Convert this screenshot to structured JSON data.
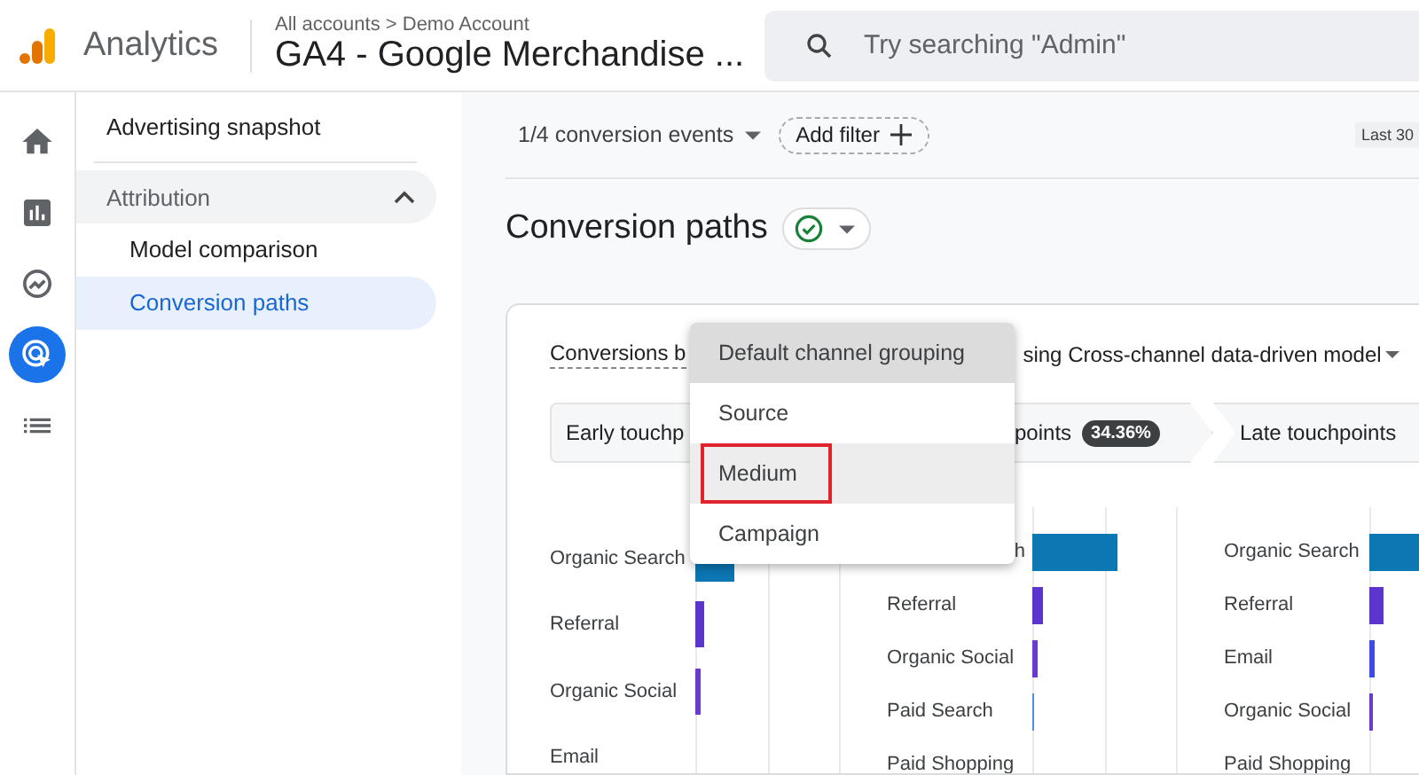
{
  "header": {
    "app_name": "Analytics",
    "breadcrumb": "All accounts > Demo Account",
    "property": "GA4 - Google Merchandise ...",
    "search": {
      "placeholder": "Try searching \"Admin\""
    }
  },
  "rail": [
    {
      "selected": false
    },
    {
      "selected": false
    },
    {
      "selected": false
    },
    {
      "selected": true
    },
    {
      "selected": false
    }
  ],
  "sidebar": {
    "items": [
      {
        "label": "Advertising snapshot",
        "kind": "link",
        "selected": false
      },
      {
        "label": "Attribution",
        "kind": "group",
        "expanded": true,
        "children": [
          {
            "label": "Model comparison",
            "selected": false
          },
          {
            "label": "Conversion paths",
            "selected": true
          }
        ]
      }
    ]
  },
  "toolbar": {
    "events": "1/4 conversion events",
    "add_filter": "Add filter",
    "date_range": "Last 30"
  },
  "page_title": "Conversion paths",
  "card": {
    "heading_start": "Conversions b",
    "heading_end": "sing Cross-channel data-driven model",
    "tabs": [
      {
        "label": "Early touchp"
      },
      {
        "label": "points",
        "badge": "34.36%"
      },
      {
        "label": "Late touchpoints"
      }
    ],
    "columns": [
      {
        "rows": [
          {
            "label": "Organic Search",
            "clipped": false,
            "color": "#0b77b3"
          },
          {
            "label": "Referral",
            "clipped": false,
            "color": "#5c35cc"
          },
          {
            "label": "Organic Social",
            "clipped": false,
            "color": "#6b3bd0"
          },
          {
            "label": "Email",
            "clipped": false
          }
        ]
      },
      {
        "rows": [
          {
            "label": "h",
            "clipped": true,
            "color": "#0b77b3"
          },
          {
            "label": "Referral",
            "clipped": false,
            "color": "#5c35cc"
          },
          {
            "label": "Organic Social",
            "clipped": false,
            "color": "#6b3bd0"
          },
          {
            "label": "Paid Search",
            "clipped": false,
            "color": "#4e8fe8"
          },
          {
            "label": "Paid Shopping",
            "clipped": false
          }
        ]
      },
      {
        "rows": [
          {
            "label": "Organic Search",
            "clipped": false,
            "color": "#0b77b3"
          },
          {
            "label": "Referral",
            "clipped": false,
            "color": "#5c35cc"
          },
          {
            "label": "Email",
            "clipped": false,
            "color": "#3b4ce6"
          },
          {
            "label": "Organic Social",
            "clipped": false,
            "color": "#6b3bd0"
          },
          {
            "label": "Paid Shopping",
            "clipped": false
          }
        ]
      }
    ]
  },
  "menu": {
    "items": [
      {
        "label": "Default channel grouping",
        "selected": true,
        "hovered": false,
        "outlined": false
      },
      {
        "label": "Source",
        "selected": false,
        "hovered": false,
        "outlined": false
      },
      {
        "label": "Medium",
        "selected": false,
        "hovered": true,
        "outlined": true
      },
      {
        "label": "Campaign",
        "selected": false,
        "hovered": false,
        "outlined": false
      }
    ]
  }
}
